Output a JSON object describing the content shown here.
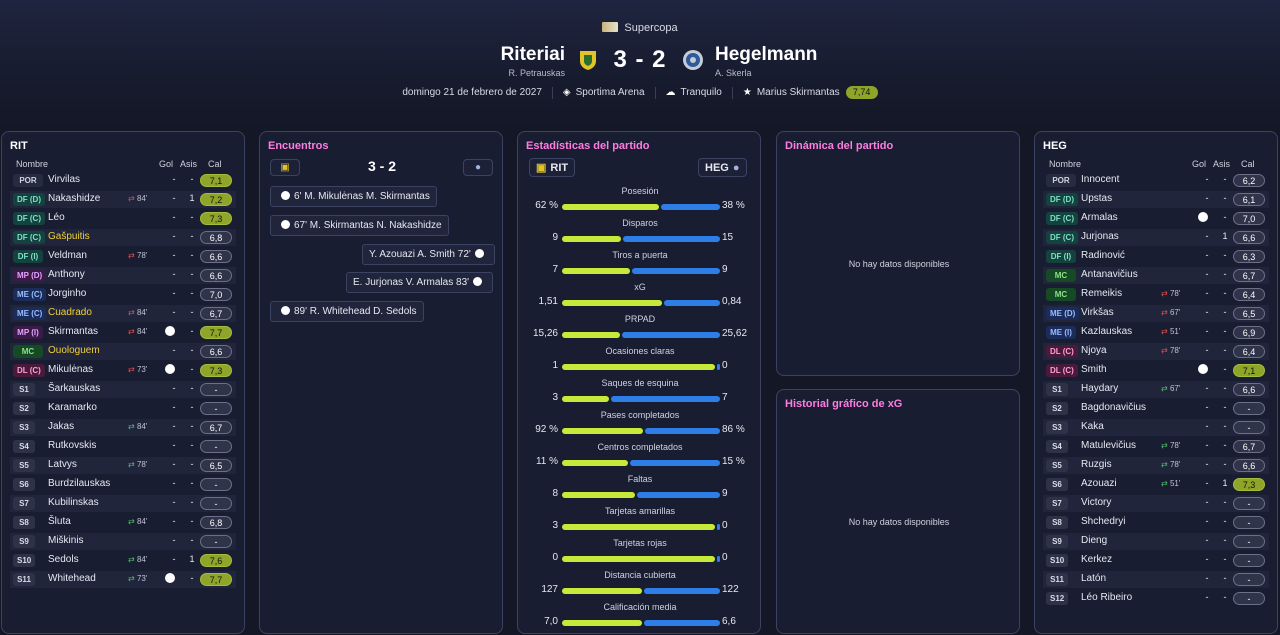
{
  "header": {
    "competition": "Supercopa",
    "home_team": "Riteriai",
    "home_manager": "R. Petrauskas",
    "away_team": "Hegelmann",
    "away_manager": "A. Skerla",
    "score": "3 - 2",
    "date": "domingo 21 de febrero de 2027",
    "stadium": "Sportima Arena",
    "weather": "Tranquilo",
    "motm_name": "Marius Skirmantas",
    "motm_rating": "7,74"
  },
  "columns": {
    "name": "Nombre",
    "goals": "Gol",
    "assists": "Asis",
    "rating": "Cal"
  },
  "home_panel": {
    "title": "RIT",
    "players": [
      {
        "pos": "POR",
        "cls": "por",
        "name": "Virvilas",
        "sub": "",
        "subtype": "",
        "card": false,
        "goals": "-",
        "assists": "-",
        "rating": "7,1",
        "good": true
      },
      {
        "pos": "DF (D)",
        "cls": "df",
        "name": "Nakashidze",
        "sub": "84'",
        "subtype": "out",
        "card": false,
        "goals": "-",
        "assists": "1",
        "rating": "7,2",
        "good": true
      },
      {
        "pos": "DF (C)",
        "cls": "df",
        "name": "Léo",
        "sub": "",
        "subtype": "",
        "card": false,
        "goals": "-",
        "assists": "-",
        "rating": "7,3",
        "good": true
      },
      {
        "pos": "DF (C)",
        "cls": "df",
        "name": "Gašpuitis",
        "yellow": true,
        "sub": "",
        "subtype": "",
        "card": false,
        "goals": "-",
        "assists": "-",
        "rating": "6,8",
        "good": false
      },
      {
        "pos": "DF (I)",
        "cls": "df",
        "name": "Veldman",
        "sub": "78'",
        "subtype": "out",
        "card": false,
        "goals": "-",
        "assists": "-",
        "rating": "6,6",
        "good": false
      },
      {
        "pos": "MP (D)",
        "cls": "mp",
        "name": "Anthony",
        "sub": "",
        "subtype": "",
        "card": false,
        "goals": "-",
        "assists": "-",
        "rating": "6,6",
        "good": false
      },
      {
        "pos": "ME (C)",
        "cls": "me",
        "name": "Jorginho",
        "sub": "",
        "subtype": "",
        "card": false,
        "goals": "-",
        "assists": "-",
        "rating": "7,0",
        "good": false
      },
      {
        "pos": "ME (C)",
        "cls": "me",
        "name": "Cuadrado",
        "yellow": true,
        "sub": "84'",
        "subtype": "out",
        "card": false,
        "goals": "-",
        "assists": "-",
        "rating": "6,7",
        "good": false
      },
      {
        "pos": "MP (I)",
        "cls": "mp",
        "name": "Skirmantas",
        "sub": "84'",
        "subtype": "out",
        "card": true,
        "goals": "1",
        "assists": "-",
        "rating": "7,7",
        "good": true
      },
      {
        "pos": "MC",
        "cls": "mc",
        "name": "Ouologuem",
        "yellow": true,
        "sub": "",
        "subtype": "",
        "card": false,
        "goals": "-",
        "assists": "-",
        "rating": "6,6",
        "good": false
      },
      {
        "pos": "DL (C)",
        "cls": "dl",
        "name": "Mikulėnas",
        "sub": "73'",
        "subtype": "out",
        "card": true,
        "goals": "-",
        "assists": "-",
        "rating": "7,3",
        "good": true
      },
      {
        "pos": "S1",
        "cls": "s",
        "name": "Šarkauskas",
        "sub": "",
        "subtype": "",
        "card": false,
        "goals": "-",
        "assists": "-",
        "rating": "-",
        "good": false
      },
      {
        "pos": "S2",
        "cls": "s",
        "name": "Karamarko",
        "sub": "",
        "subtype": "",
        "card": false,
        "goals": "-",
        "assists": "-",
        "rating": "-",
        "good": false
      },
      {
        "pos": "S3",
        "cls": "s",
        "name": "Jakas",
        "sub": "84'",
        "subtype": "in",
        "card": false,
        "goals": "-",
        "assists": "-",
        "rating": "6,7",
        "good": false
      },
      {
        "pos": "S4",
        "cls": "s",
        "name": "Rutkovskis",
        "sub": "",
        "subtype": "",
        "card": false,
        "goals": "-",
        "assists": "-",
        "rating": "-",
        "good": false
      },
      {
        "pos": "S5",
        "cls": "s",
        "name": "Latvys",
        "sub": "78'",
        "subtype": "in",
        "card": false,
        "goals": "-",
        "assists": "-",
        "rating": "6,5",
        "good": false
      },
      {
        "pos": "S6",
        "cls": "s",
        "name": "Burdzilauskas",
        "sub": "",
        "subtype": "",
        "card": false,
        "goals": "-",
        "assists": "-",
        "rating": "-",
        "good": false
      },
      {
        "pos": "S7",
        "cls": "s",
        "name": "Kubilinskas",
        "sub": "",
        "subtype": "",
        "card": false,
        "goals": "-",
        "assists": "-",
        "rating": "-",
        "good": false
      },
      {
        "pos": "S8",
        "cls": "s",
        "name": "Šluta",
        "sub": "84'",
        "subtype": "in",
        "card": false,
        "goals": "-",
        "assists": "-",
        "rating": "6,8",
        "good": false
      },
      {
        "pos": "S9",
        "cls": "s",
        "name": "Miškinis",
        "sub": "",
        "subtype": "",
        "card": false,
        "goals": "-",
        "assists": "-",
        "rating": "-",
        "good": false
      },
      {
        "pos": "S10",
        "cls": "s",
        "name": "Sedols",
        "sub": "84'",
        "subtype": "in",
        "card": false,
        "goals": "-",
        "assists": "1",
        "rating": "7,6",
        "good": true
      },
      {
        "pos": "S11",
        "cls": "s",
        "name": "Whitehead",
        "sub": "73'",
        "subtype": "in",
        "card": true,
        "goals": "-",
        "assists": "-",
        "rating": "7,7",
        "good": true
      }
    ]
  },
  "away_panel": {
    "title": "HEG",
    "players": [
      {
        "pos": "POR",
        "cls": "por",
        "name": "Innocent",
        "sub": "",
        "subtype": "",
        "card": false,
        "goals": "-",
        "assists": "-",
        "rating": "6,2",
        "good": false
      },
      {
        "pos": "DF (D)",
        "cls": "df",
        "name": "Upstas",
        "sub": "",
        "subtype": "",
        "card": false,
        "goals": "-",
        "assists": "-",
        "rating": "6,1",
        "good": false
      },
      {
        "pos": "DF (C)",
        "cls": "df",
        "name": "Armalas",
        "sub": "",
        "subtype": "",
        "card": true,
        "goals": "-",
        "assists": "-",
        "rating": "7,0",
        "good": false
      },
      {
        "pos": "DF (C)",
        "cls": "df",
        "name": "Jurjonas",
        "sub": "",
        "subtype": "",
        "card": false,
        "goals": "-",
        "assists": "1",
        "rating": "6,6",
        "good": false
      },
      {
        "pos": "DF (I)",
        "cls": "df",
        "name": "Radinović",
        "sub": "",
        "subtype": "",
        "card": false,
        "goals": "-",
        "assists": "-",
        "rating": "6,3",
        "good": false
      },
      {
        "pos": "MC",
        "cls": "mc",
        "name": "Antanavičius",
        "sub": "",
        "subtype": "",
        "card": false,
        "goals": "-",
        "assists": "-",
        "rating": "6,7",
        "good": false
      },
      {
        "pos": "MC",
        "cls": "mc",
        "name": "Remeikis",
        "sub": "78'",
        "subtype": "out",
        "card": false,
        "goals": "-",
        "assists": "-",
        "rating": "6,4",
        "good": false
      },
      {
        "pos": "ME (D)",
        "cls": "me",
        "name": "Virkšas",
        "sub": "67'",
        "subtype": "out",
        "card": false,
        "goals": "-",
        "assists": "-",
        "rating": "6,5",
        "good": false
      },
      {
        "pos": "ME (I)",
        "cls": "me",
        "name": "Kazlauskas",
        "sub": "51'",
        "subtype": "out",
        "card": false,
        "goals": "-",
        "assists": "-",
        "rating": "6,9",
        "good": false
      },
      {
        "pos": "DL (C)",
        "cls": "dl",
        "name": "Njoya",
        "sub": "78'",
        "subtype": "out",
        "card": false,
        "goals": "-",
        "assists": "-",
        "rating": "6,4",
        "good": false
      },
      {
        "pos": "DL (C)",
        "cls": "dl",
        "name": "Smith",
        "sub": "",
        "subtype": "",
        "card": true,
        "goals": "-",
        "assists": "-",
        "rating": "7,1",
        "good": true
      },
      {
        "pos": "S1",
        "cls": "s",
        "name": "Haydary",
        "sub": "67'",
        "subtype": "in",
        "card": false,
        "goals": "-",
        "assists": "-",
        "rating": "6,6",
        "good": false
      },
      {
        "pos": "S2",
        "cls": "s",
        "name": "Bagdonavičius",
        "sub": "",
        "subtype": "",
        "card": false,
        "goals": "-",
        "assists": "-",
        "rating": "-",
        "good": false
      },
      {
        "pos": "S3",
        "cls": "s",
        "name": "Kaka",
        "sub": "",
        "subtype": "",
        "card": false,
        "goals": "-",
        "assists": "-",
        "rating": "-",
        "good": false
      },
      {
        "pos": "S4",
        "cls": "s",
        "name": "Matulevičius",
        "sub": "78'",
        "subtype": "in",
        "card": false,
        "goals": "-",
        "assists": "-",
        "rating": "6,7",
        "good": false
      },
      {
        "pos": "S5",
        "cls": "s",
        "name": "Ruzgis",
        "sub": "78'",
        "subtype": "in",
        "card": false,
        "goals": "-",
        "assists": "-",
        "rating": "6,6",
        "good": false
      },
      {
        "pos": "S6",
        "cls": "s",
        "name": "Azouazi",
        "sub": "51'",
        "subtype": "in",
        "card": false,
        "goals": "-",
        "assists": "1",
        "rating": "7,3",
        "good": true
      },
      {
        "pos": "S7",
        "cls": "s",
        "name": "Victory",
        "sub": "",
        "subtype": "",
        "card": false,
        "goals": "-",
        "assists": "-",
        "rating": "-",
        "good": false
      },
      {
        "pos": "S8",
        "cls": "s",
        "name": "Shchedryi",
        "sub": "",
        "subtype": "",
        "card": false,
        "goals": "-",
        "assists": "-",
        "rating": "-",
        "good": false
      },
      {
        "pos": "S9",
        "cls": "s",
        "name": "Dieng",
        "sub": "",
        "subtype": "",
        "card": false,
        "goals": "-",
        "assists": "-",
        "rating": "-",
        "good": false
      },
      {
        "pos": "S10",
        "cls": "s",
        "name": "Kerkez",
        "sub": "",
        "subtype": "",
        "card": false,
        "goals": "-",
        "assists": "-",
        "rating": "-",
        "good": false
      },
      {
        "pos": "S11",
        "cls": "s",
        "name": "Latón",
        "sub": "",
        "subtype": "",
        "card": false,
        "goals": "-",
        "assists": "-",
        "rating": "-",
        "good": false
      },
      {
        "pos": "S12",
        "cls": "s",
        "name": "Léo Ribeiro",
        "sub": "",
        "subtype": "",
        "card": false,
        "goals": "-",
        "assists": "-",
        "rating": "-",
        "good": false
      }
    ]
  },
  "encounters": {
    "title": "Encuentros",
    "score": "3 - 2",
    "events": [
      {
        "text": "6' M. Mikulėnas M. Skirmantas",
        "side": "home"
      },
      {
        "text": "67' M. Skirmantas N. Nakashidze",
        "side": "home"
      },
      {
        "text": "Y. Azouazi A. Smith 72'",
        "side": "away"
      },
      {
        "text": "E. Jurjonas V. Armalas 83'",
        "side": "away"
      },
      {
        "text": "89' R. Whitehead D. Sedols",
        "side": "home"
      }
    ]
  },
  "stats": {
    "title": "Estadísticas del partido",
    "home_abbr": "RIT",
    "away_abbr": "HEG",
    "rows": [
      {
        "label": "Posesión",
        "home": "62 %",
        "away": "38 %",
        "hf": 0.62
      },
      {
        "label": "Disparos",
        "home": "9",
        "away": "15",
        "hf": 0.375
      },
      {
        "label": "Tiros a puerta",
        "home": "7",
        "away": "9",
        "hf": 0.4375
      },
      {
        "label": "xG",
        "home": "1,51",
        "away": "0,84",
        "hf": 0.64
      },
      {
        "label": "PRPAD",
        "home": "15,26",
        "away": "25,62",
        "hf": 0.37
      },
      {
        "label": "Ocasiones claras",
        "home": "1",
        "away": "0",
        "hf": 0.98
      },
      {
        "label": "Saques de esquina",
        "home": "3",
        "away": "7",
        "hf": 0.3
      },
      {
        "label": "Pases completados",
        "home": "92 %",
        "away": "86 %",
        "hf": 0.52
      },
      {
        "label": "Centros completados",
        "home": "11 %",
        "away": "15 %",
        "hf": 0.42
      },
      {
        "label": "Faltas",
        "home": "8",
        "away": "9",
        "hf": 0.47
      },
      {
        "label": "Tarjetas amarillas",
        "home": "3",
        "away": "0",
        "hf": 0.98
      },
      {
        "label": "Tarjetas rojas",
        "home": "0",
        "away": "0",
        "hf": 0.98
      },
      {
        "label": "Distancia cubierta",
        "home": "127",
        "away": "122",
        "hf": 0.51
      },
      {
        "label": "Calificación media",
        "home": "7,0",
        "away": "6,6",
        "hf": 0.51
      }
    ]
  },
  "dynamics": {
    "title": "Dinámica del partido",
    "empty": "No hay datos disponibles"
  },
  "xg_history": {
    "title": "Historial gráfico de xG",
    "empty": "No hay datos disponibles"
  },
  "colors": {
    "accent": "#ff7ce0",
    "home_bar": "#c7ea3a",
    "away_bar": "#2f7ee8",
    "good_rating": "#8ea52a"
  }
}
